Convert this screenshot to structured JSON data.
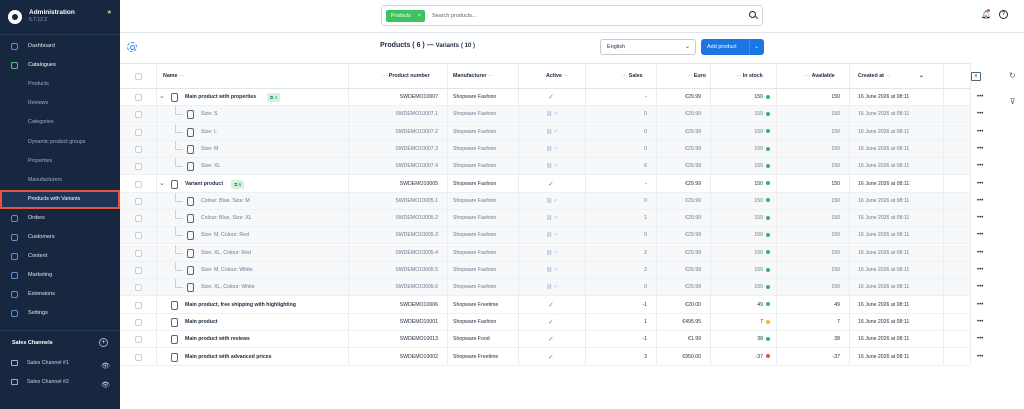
{
  "sidebar": {
    "app_title": "Administration",
    "version": "6.7.12.2",
    "nav": [
      {
        "label": "Dashboard",
        "icon": "dashboard-icon",
        "level": "top"
      },
      {
        "label": "Catalogues",
        "icon": "catalogue-icon",
        "level": "cat"
      },
      {
        "label": "Products",
        "level": "sub"
      },
      {
        "label": "Reviews",
        "level": "sub"
      },
      {
        "label": "Categories",
        "level": "sub"
      },
      {
        "label": "Dynamic product groups",
        "level": "sub"
      },
      {
        "label": "Properties",
        "level": "sub"
      },
      {
        "label": "Manufacturers",
        "level": "sub"
      },
      {
        "label": "Products with Variants",
        "level": "sub",
        "active": true
      },
      {
        "label": "Orders",
        "icon": "orders-icon",
        "level": "top"
      },
      {
        "label": "Customers",
        "icon": "customers-icon",
        "level": "top"
      },
      {
        "label": "Content",
        "icon": "content-icon",
        "level": "top"
      },
      {
        "label": "Marketing",
        "icon": "marketing-icon",
        "level": "top"
      },
      {
        "label": "Extensions",
        "icon": "extensions-icon",
        "level": "top"
      },
      {
        "label": "Settings",
        "icon": "settings-icon",
        "level": "top"
      }
    ],
    "sales_channels_title": "Sales Channels",
    "sales_channels": [
      {
        "label": "Sales Channel #1"
      },
      {
        "label": "Sales Channel #2"
      }
    ]
  },
  "search": {
    "filter_chip": "Products",
    "placeholder": "Search products..."
  },
  "toolbar": {
    "title": "Products",
    "product_count": "( 6 )",
    "separator": "—",
    "variants_label": "Variants",
    "variants_count": "( 10 )",
    "language": "English",
    "add_button": "Add product"
  },
  "columns": {
    "name": "Name",
    "product_number": "Product number",
    "manufacturer": "Manufacturer",
    "active": "Active",
    "sales": "Sales",
    "euro": "Euro",
    "in_stock": "In stock",
    "available": "Available",
    "created_at": "Created at"
  },
  "colors": {
    "stock_ok": "#37b75a",
    "stock_low": "#f2b92a",
    "stock_out": "#e8523e",
    "accent": "#1b75e3"
  },
  "rows": [
    {
      "type": "parent",
      "name": "Main product with properties",
      "badge": "4",
      "number": "SWDEMO10007",
      "manufacturer": "Shopware Fashion",
      "active": "✓",
      "sales": "-",
      "price": "€29.99",
      "stock": "150",
      "stock_state": "ok",
      "available": "150",
      "created": "16 June 2026 at 08:11"
    },
    {
      "type": "variant",
      "name": "Size: S",
      "number": "SWDEMO10007.1",
      "manufacturer": "Shopware Fashion",
      "active": "inherit",
      "sales": "0",
      "price": "€29.99",
      "stock": "150",
      "stock_state": "ok",
      "available": "150",
      "created": "16 June 2026 at 08:11"
    },
    {
      "type": "variant",
      "name": "Size: L",
      "number": "SWDEMO10007.2",
      "manufacturer": "Shopware Fashion",
      "active": "inherit",
      "sales": "0",
      "price": "€29.99",
      "stock": "150",
      "stock_state": "ok",
      "available": "150",
      "created": "16 June 2026 at 08:11"
    },
    {
      "type": "variant",
      "name": "Size: M",
      "number": "SWDEMO10007.3",
      "manufacturer": "Shopware Fashion",
      "active": "inherit",
      "sales": "0",
      "price": "€29.99",
      "stock": "150",
      "stock_state": "ok",
      "available": "150",
      "created": "16 June 2026 at 08:11"
    },
    {
      "type": "variant",
      "name": "Size: XL",
      "number": "SWDEMO10007.4",
      "manufacturer": "Shopware Fashion",
      "active": "inherit",
      "sales": "6",
      "price": "€29.99",
      "stock": "150",
      "stock_state": "ok",
      "available": "150",
      "created": "16 June 2026 at 08:11"
    },
    {
      "type": "parent",
      "name": "Variant product",
      "badge": "6",
      "number": "SWDEMO10005",
      "manufacturer": "Shopware Fashion",
      "active": "✓",
      "sales": "-",
      "price": "€29.99",
      "stock": "150",
      "stock_state": "ok",
      "available": "150",
      "created": "16 June 2026 at 08:11"
    },
    {
      "type": "variant",
      "name": "Colour: Blue, Size: M",
      "number": "SWDEMO10005.1",
      "manufacturer": "Shopware Fashion",
      "active": "inherit",
      "sales": "0",
      "price": "€29.99",
      "stock": "150",
      "stock_state": "ok",
      "available": "150",
      "created": "16 June 2026 at 08:11"
    },
    {
      "type": "variant",
      "name": "Colour: Blue, Size: XL",
      "number": "SWDEMO10005.2",
      "manufacturer": "Shopware Fashion",
      "active": "inherit",
      "sales": "1",
      "price": "€29.99",
      "stock": "150",
      "stock_state": "ok",
      "available": "150",
      "created": "16 June 2026 at 08:11"
    },
    {
      "type": "variant",
      "name": "Size: M, Colour: Red",
      "number": "SWDEMO10005.3",
      "manufacturer": "Shopware Fashion",
      "active": "inherit",
      "sales": "0",
      "price": "€29.99",
      "stock": "150",
      "stock_state": "ok",
      "available": "150",
      "created": "16 June 2026 at 08:11"
    },
    {
      "type": "variant",
      "name": "Size: XL, Colour: Red",
      "number": "SWDEMO10005.4",
      "manufacturer": "Shopware Fashion",
      "active": "inherit",
      "sales": "2",
      "price": "€29.99",
      "stock": "150",
      "stock_state": "ok",
      "available": "150",
      "created": "16 June 2026 at 08:11"
    },
    {
      "type": "variant",
      "name": "Size: M, Colour: White",
      "number": "SWDEMO10005.5",
      "manufacturer": "Shopware Fashion",
      "active": "inherit",
      "sales": "2",
      "price": "€29.99",
      "stock": "150",
      "stock_state": "ok",
      "available": "150",
      "created": "16 June 2026 at 08:11"
    },
    {
      "type": "variant",
      "name": "Size: XL, Colour: White",
      "number": "SWDEMO10005.6",
      "manufacturer": "Shopware Fashion",
      "active": "inherit",
      "sales": "0",
      "price": "€29.99",
      "stock": "150",
      "stock_state": "ok",
      "available": "150",
      "created": "16 June 2026 at 08:11"
    },
    {
      "type": "single",
      "name": "Main product, free shipping with highlighting",
      "number": "SWDEMO10006",
      "manufacturer": "Shopware Freetime",
      "active": "✓",
      "sales": "-1",
      "price": "€20.00",
      "stock": "49",
      "stock_state": "ok",
      "available": "49",
      "created": "16 June 2026 at 08:11",
      "icon": "glasses-icon"
    },
    {
      "type": "single",
      "name": "Main product",
      "number": "SWDEMO10001",
      "manufacturer": "Shopware Fashion",
      "active": "✓",
      "sales": "1",
      "price": "€495.95",
      "stock": "7",
      "stock_state": "low",
      "available": "7",
      "created": "16 June 2026 at 08:11",
      "icon": "phone-icon"
    },
    {
      "type": "single",
      "name": "Main product with reviews",
      "number": "SWDEMO10013",
      "manufacturer": "Shopware Food",
      "active": "✓",
      "sales": "-1",
      "price": "€1.99",
      "stock": "38",
      "stock_state": "ok",
      "available": "38",
      "created": "16 June 2026 at 08:11",
      "icon": "bottle-icon"
    },
    {
      "type": "single",
      "name": "Main product with advanced prices",
      "number": "SWDEMO10002",
      "manufacturer": "Shopware Freetime",
      "active": "✓",
      "sales": "3",
      "price": "€950.00",
      "stock": "-37",
      "stock_state": "out",
      "available": "-37",
      "created": "16 June 2026 at 08:11",
      "icon": "frame-icon"
    }
  ]
}
